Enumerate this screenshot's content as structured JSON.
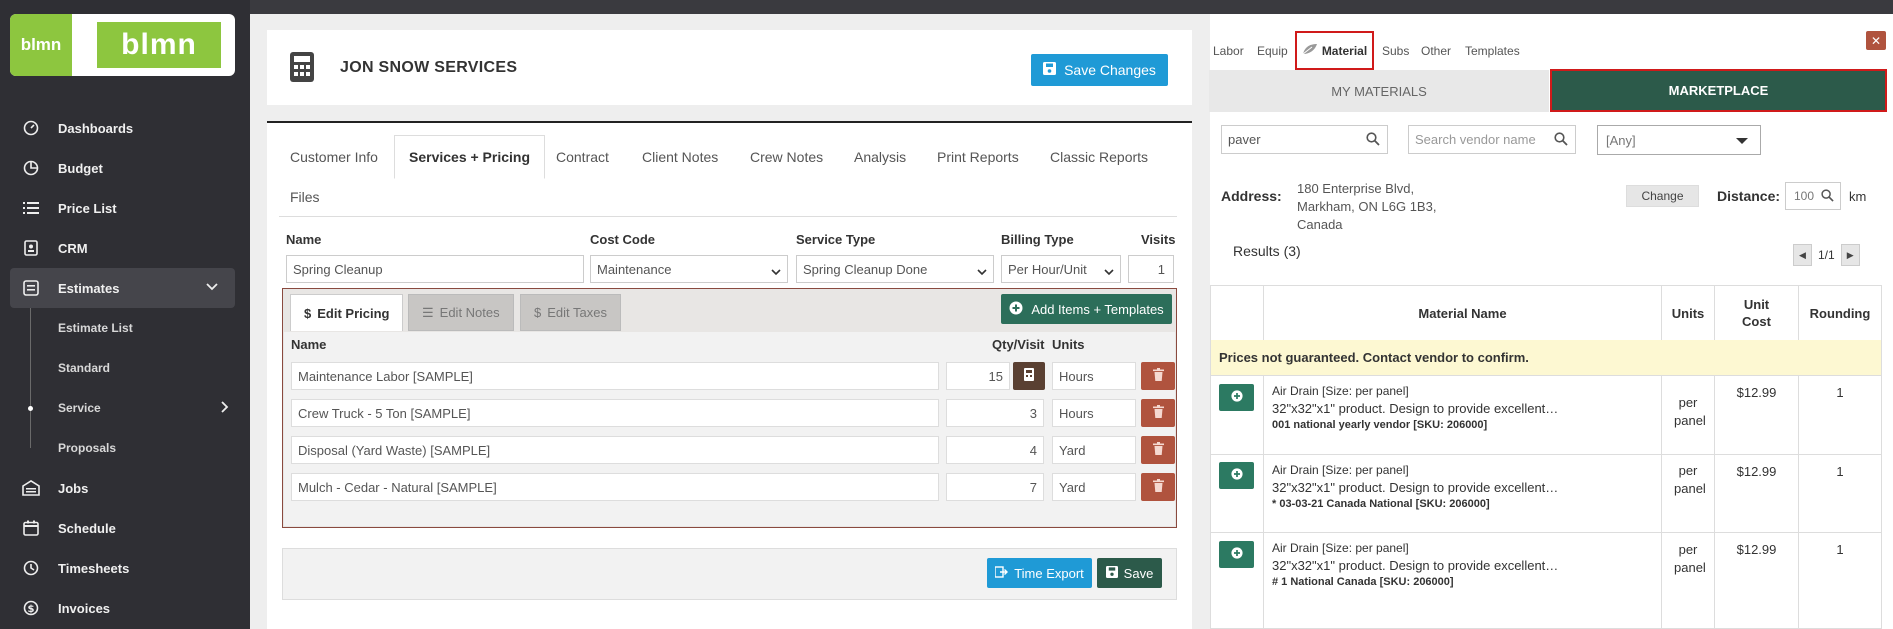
{
  "sidebar": {
    "logo_small": "blmn",
    "logo_large": "blmn",
    "items": [
      {
        "label": "Dashboards"
      },
      {
        "label": "Budget"
      },
      {
        "label": "Price List"
      },
      {
        "label": "CRM"
      },
      {
        "label": "Estimates"
      },
      {
        "label": "Estimate List"
      },
      {
        "label": "Standard"
      },
      {
        "label": "Service"
      },
      {
        "label": "Proposals"
      },
      {
        "label": "Jobs"
      },
      {
        "label": "Schedule"
      },
      {
        "label": "Timesheets"
      },
      {
        "label": "Invoices"
      }
    ]
  },
  "header": {
    "title": "JON SNOW SERVICES",
    "save_changes": "Save Changes"
  },
  "tabs": [
    {
      "label": "Customer Info"
    },
    {
      "label": "Services + Pricing"
    },
    {
      "label": "Contract"
    },
    {
      "label": "Client Notes"
    },
    {
      "label": "Crew Notes"
    },
    {
      "label": "Analysis"
    },
    {
      "label": "Print Reports"
    },
    {
      "label": "Classic Reports"
    },
    {
      "label": "Files"
    }
  ],
  "service": {
    "labels": {
      "name": "Name",
      "cost_code": "Cost Code",
      "service_type": "Service Type",
      "billing_type": "Billing Type",
      "visits": "Visits"
    },
    "name": "Spring Cleanup",
    "cost_code": "Maintenance",
    "service_type": "Spring Cleanup Done",
    "billing_type": "Per Hour/Unit",
    "visits": "1"
  },
  "pricing": {
    "tabs": [
      "Edit Pricing",
      "Edit Notes",
      "Edit Taxes"
    ],
    "add_button": "Add Items + Templates",
    "headers": {
      "name": "Name",
      "qty": "Qty/Visit",
      "units": "Units"
    },
    "rows": [
      {
        "name": "Maintenance Labor [SAMPLE]",
        "qty": "15",
        "units": "Hours"
      },
      {
        "name": "Crew Truck - 5 Ton [SAMPLE]",
        "qty": "3",
        "units": "Hours"
      },
      {
        "name": "Disposal (Yard Waste) [SAMPLE]",
        "qty": "4",
        "units": "Yard"
      },
      {
        "name": "Mulch - Cedar - Natural [SAMPLE]",
        "qty": "7",
        "units": "Yard"
      }
    ]
  },
  "footer": {
    "time_export": "Time Export",
    "save": "Save"
  },
  "right_panel": {
    "tabs": [
      "Labor",
      "Equip",
      "Material",
      "Subs",
      "Other",
      "Templates"
    ],
    "close": "✕",
    "segments": {
      "my": "MY MATERIALS",
      "market": "MARKETPLACE"
    },
    "search_value": "paver",
    "vendor_placeholder": "Search vendor name",
    "select_value": "[Any]",
    "address_label": "Address:",
    "address": "180 Enterprise Blvd, Markham, ON L6G 1B3, Canada",
    "change": "Change",
    "distance_label": "Distance:",
    "distance": "100",
    "distance_unit": "km",
    "results": "Results (3)",
    "pager": "1/1",
    "headers": {
      "name": "Material Name",
      "units": "Units",
      "unit_cost": "Unit Cost",
      "rounding": "Rounding"
    },
    "notice": "Prices not guaranteed. Contact vendor to confirm.",
    "rows": [
      {
        "title": "Air Drain [Size: per panel]",
        "desc": "32\"x32\"x1\" product. Design to provide excellent…",
        "vendor": "001 national yearly vendor [SKU: 206000]",
        "units": "per panel",
        "cost": "$12.99",
        "rounding": "1"
      },
      {
        "title": "Air Drain [Size: per panel]",
        "desc": "32\"x32\"x1\" product. Design to provide excellent…",
        "vendor": "* 03-03-21 Canada National [SKU: 206000]",
        "units": "per panel",
        "cost": "$12.99",
        "rounding": "1"
      },
      {
        "title": "Air Drain [Size: per panel]",
        "desc": "32\"x32\"x1\" product. Design to provide excellent…",
        "vendor": "# 1 National Canada [SKU: 206000]",
        "units": "per panel",
        "cost": "$12.99",
        "rounding": "1"
      }
    ]
  },
  "colors": {
    "accent_green": "#8dc63f",
    "dark_green": "#2c5a4a",
    "blue": "#1f9ad6",
    "red_highlight": "#d01a1a",
    "trash": "#b0533e"
  }
}
